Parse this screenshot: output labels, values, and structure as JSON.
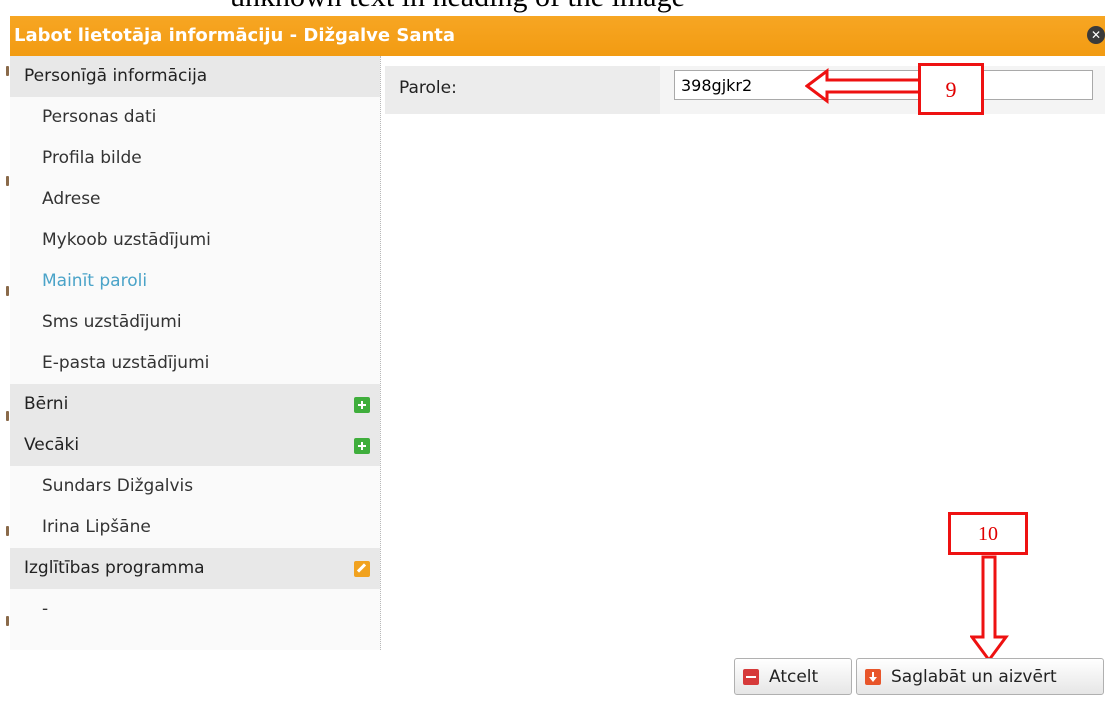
{
  "document_text": "unknown text in heading of the image",
  "dialog": {
    "title": "Labot lietotāja informāciju - Dižgalve Santa",
    "close_icon": "close-icon"
  },
  "sidebar": {
    "sections": [
      {
        "label": "Personīgā informācija"
      },
      {
        "label": "Bērni",
        "icon": "plus-icon"
      },
      {
        "label": "Vecāki",
        "icon": "plus-icon"
      },
      {
        "label": "Izglītības programma",
        "icon": "edit-icon"
      }
    ],
    "personal_items": [
      {
        "label": "Personas dati"
      },
      {
        "label": "Profila bilde"
      },
      {
        "label": "Adrese"
      },
      {
        "label": "Mykoob uzstādījumi"
      },
      {
        "label": "Mainīt paroli",
        "active": true
      },
      {
        "label": "Sms uzstādījumi"
      },
      {
        "label": "E-pasta uzstādījumi"
      }
    ],
    "parents": [
      {
        "label": "Sundars Dižgalvis"
      },
      {
        "label": "Irina Lipšāne"
      }
    ],
    "programs": [
      {
        "label": "-"
      }
    ]
  },
  "form": {
    "password_label": "Parole:",
    "password_value": "398gjkr2"
  },
  "annotations": {
    "callout_9": "9",
    "callout_10": "10",
    "color": "#ee1111"
  },
  "buttons": {
    "cancel": "Atcelt",
    "save_close": "Saglabāt un aizvērt"
  },
  "colors": {
    "titlebar": "#f29b12",
    "active_link": "#4aa3c8",
    "plus_icon": "#3fae3c",
    "edit_icon": "#f1a21f",
    "cancel_icon": "#d63a3a",
    "save_icon": "#e8552a"
  }
}
